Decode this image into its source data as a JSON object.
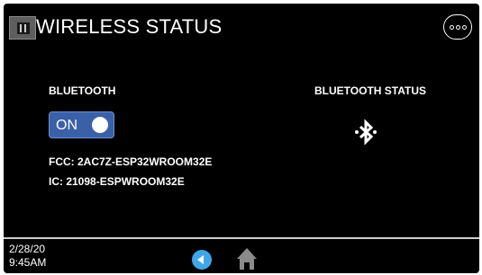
{
  "header": {
    "title": "WIRELESS STATUS",
    "logo_icon": "app-logo-icon",
    "more_icon": "more-options-icon"
  },
  "bluetooth": {
    "label": "BLUETOOTH",
    "toggle_label": "ON",
    "toggle_state": true,
    "fcc": "FCC: 2AC7Z-ESP32WROOM32E",
    "ic": "IC: 21098-ESPWROOM32E"
  },
  "bluetooth_status": {
    "label": "BLUETOOTH STATUS",
    "icon": "bluetooth-icon"
  },
  "footer": {
    "date": "2/28/20",
    "time": "9:45AM",
    "back_icon": "back-arrow-icon",
    "home_icon": "home-icon"
  },
  "colors": {
    "background": "#000000",
    "text": "#ffffff",
    "toggle": "#3a60a8",
    "back_button": "#3fa6ea",
    "home_icon": "#8a8a8a"
  }
}
